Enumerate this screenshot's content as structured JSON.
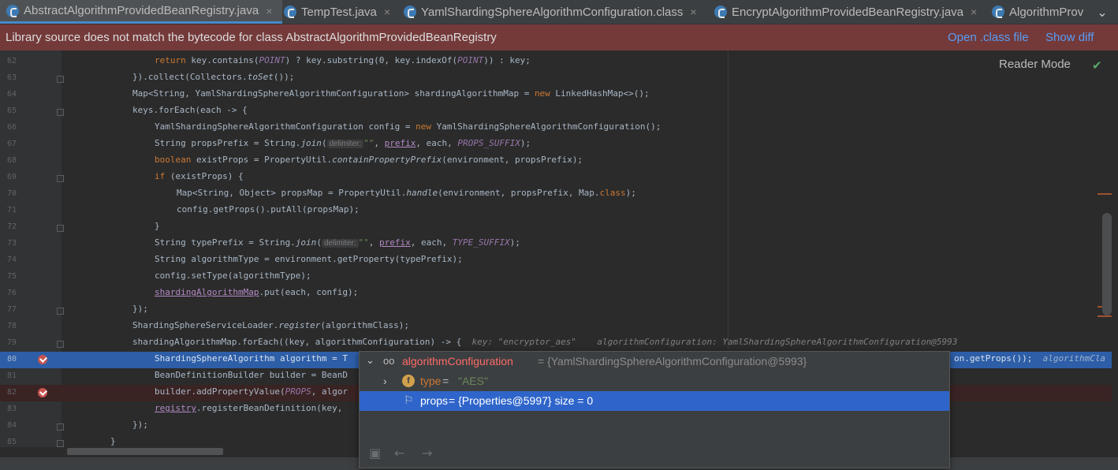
{
  "tabs": [
    {
      "label": "AbstractAlgorithmProvidedBeanRegistry.java",
      "close": "×"
    },
    {
      "label": "TempTest.java",
      "close": "×"
    },
    {
      "label": "YamlShardingSphereAlgorithmConfiguration.class",
      "close": "×"
    },
    {
      "label": "EncryptAlgorithmProvidedBeanRegistry.java",
      "close": "×"
    },
    {
      "label": "AlgorithmProv"
    }
  ],
  "tab_more_icon": "chevron-down-icon",
  "banner": {
    "message": "Library source does not match the bytecode for class AbstractAlgorithmProvidedBeanRegistry",
    "open_class": "Open .class file",
    "show_diff": "Show diff"
  },
  "reader_mode": {
    "label": "Reader Mode",
    "check": "✔"
  },
  "lines": [
    {
      "n": "62"
    },
    {
      "n": "63"
    },
    {
      "n": "64"
    },
    {
      "n": "65"
    },
    {
      "n": "66"
    },
    {
      "n": "67"
    },
    {
      "n": "68"
    },
    {
      "n": "69"
    },
    {
      "n": "70"
    },
    {
      "n": "71"
    },
    {
      "n": "72"
    },
    {
      "n": "73"
    },
    {
      "n": "74"
    },
    {
      "n": "75"
    },
    {
      "n": "76"
    },
    {
      "n": "77"
    },
    {
      "n": "78"
    },
    {
      "n": "79"
    },
    {
      "n": "80"
    },
    {
      "n": "81"
    },
    {
      "n": "82"
    },
    {
      "n": "83"
    },
    {
      "n": "84"
    },
    {
      "n": "85"
    }
  ],
  "code": {
    "l62": {
      "a": "return",
      "b": " key.contains(",
      "c": "POINT",
      "d": ") ? key.substring(0, key.indexOf(",
      "e": "POINT",
      "f": ")) : key;"
    },
    "l63": {
      "a": "}).collect(Collectors.",
      "b": "toSet",
      "c": "());"
    },
    "l64": {
      "a": "Map<String, YamlShardingSphereAlgorithmConfiguration> shardingAlgorithmMap = ",
      "b": "new",
      "c": " LinkedHashMap<>();"
    },
    "l65": {
      "a": "keys.forEach(each -> {"
    },
    "l66": {
      "a": "YamlShardingSphereAlgorithmConfiguration config = ",
      "b": "new",
      "c": " YamlShardingSphereAlgorithmConfiguration();"
    },
    "l67": {
      "a": "String propsPrefix = String.",
      "b": "join",
      "c": "(",
      "hint": "delimiter:",
      "d": "\"\"",
      "e": ", ",
      "f": "prefix",
      "g": ", each, ",
      "h": "PROPS_SUFFIX",
      "i": ");"
    },
    "l68": {
      "a": "boolean",
      "b": " existProps = PropertyUtil.",
      "c": "containPropertyPrefix",
      "d": "(environment, propsPrefix);"
    },
    "l69": {
      "a": "if",
      "b": " (existProps) {"
    },
    "l70": {
      "a": "Map<String, Object> propsMap = PropertyUtil.",
      "b": "handle",
      "c": "(environment, propsPrefix, Map.",
      "d": "class",
      "e": ");"
    },
    "l71": {
      "a": "config.getProps().putAll(propsMap);"
    },
    "l72": {
      "a": "}"
    },
    "l73": {
      "a": "String typePrefix = String.",
      "b": "join",
      "c": "(",
      "hint": "delimiter:",
      "d": "\"\"",
      "e": ", ",
      "f": "prefix",
      "g": ", each, ",
      "h": "TYPE_SUFFIX",
      "i": ");"
    },
    "l74": {
      "a": "String algorithmType = environment.getProperty(typePrefix);"
    },
    "l75": {
      "a": "config.setType(algorithmType);"
    },
    "l76": {
      "a": "shardingAlgorithmMap",
      "b": ".put(each, config);"
    },
    "l77": {
      "a": "});"
    },
    "l78": {
      "a": "ShardingSphereServiceLoader.",
      "b": "register",
      "c": "(algorithmClass);"
    },
    "l79": {
      "a": "shardingAlgorithmMap.forEach((key, algorithmConfiguration) -> {",
      "inline": "  key: \"encryptor_aes\"    algorithmConfiguration: YamlShardingSphereAlgorithmConfiguration@5993"
    },
    "l80": {
      "a": "ShardingSphereAlgorithm algorithm = T",
      "b": "on.getProps());",
      "inline": "  algorithmCla"
    },
    "l81": {
      "a": "BeanDefinitionBuilder builder = BeanD"
    },
    "l82": {
      "a": "builder.addPropertyValue(",
      "b": "PROPS",
      "c": ", algor"
    },
    "l83": {
      "a": "registry",
      "b": ".registerBeanDefinition(key,"
    },
    "l84": {
      "a": "});"
    },
    "l85": {
      "a": "}"
    }
  },
  "popup": {
    "root": {
      "name": "algorithmConfiguration",
      "value": " = {YamlShardingSphereAlgorithmConfiguration@5993}",
      "name_color": "#ff6b68"
    },
    "type_row": {
      "badge": "f",
      "name": "type",
      "eq": " = ",
      "value": "\"AES\""
    },
    "props_row": {
      "name": "props",
      "value": " = {Properties@5997}  size = 0"
    },
    "toolbar_icons": [
      "watch-icon",
      "back-arrow-icon",
      "forward-arrow-icon"
    ]
  },
  "colors": {
    "accent": "#4a88c7",
    "banner_bg": "#743a3a",
    "debug_line": "#2d5ea7",
    "selection": "#2f65ca"
  }
}
